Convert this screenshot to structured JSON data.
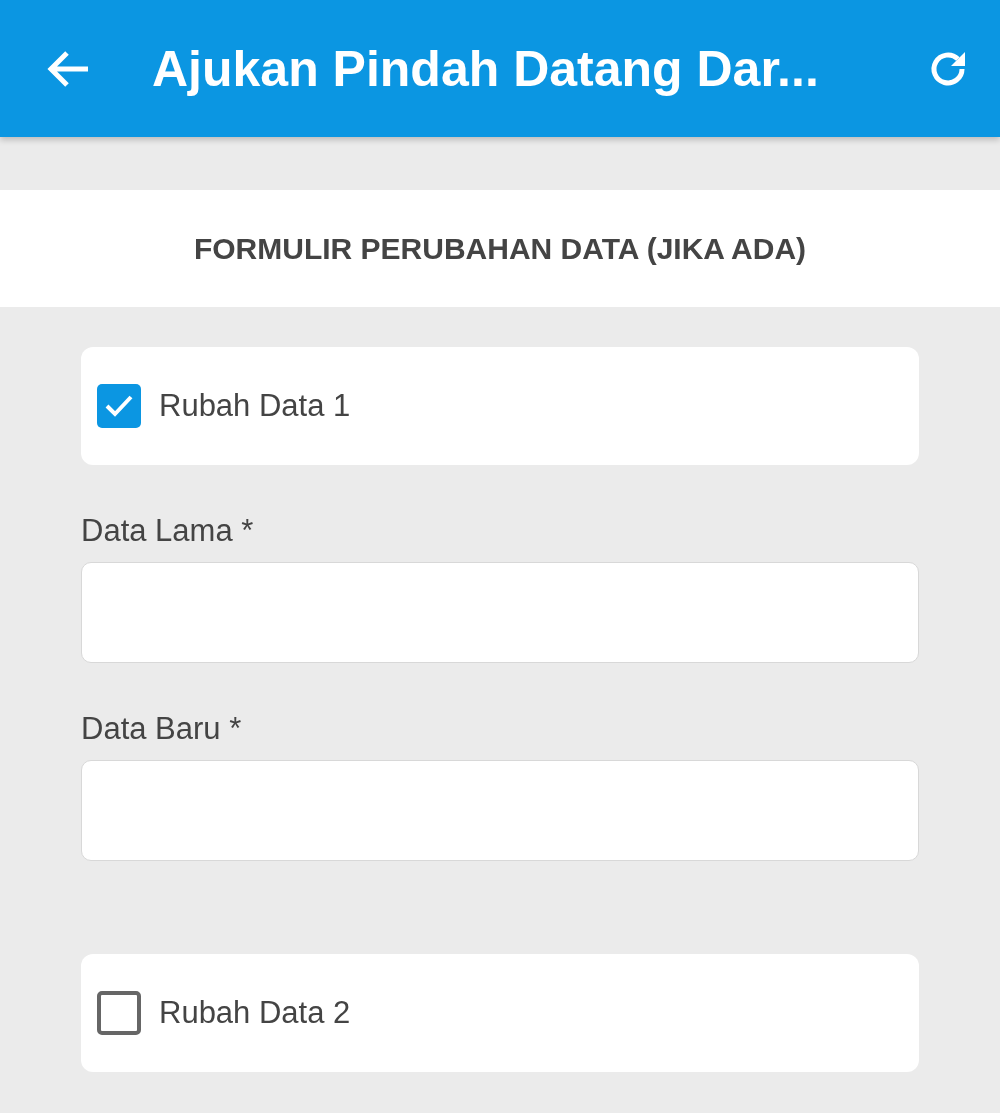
{
  "app_bar": {
    "title": "Ajukan Pindah Datang Dar..."
  },
  "section": {
    "title": "FORMULIR PERUBAHAN DATA (JIKA ADA)"
  },
  "form_items": [
    {
      "kind": "checkbox",
      "label": "Rubah Data 1",
      "checked": true
    },
    {
      "kind": "field",
      "label": "Data Lama *"
    },
    {
      "kind": "field",
      "label": "Data Baru *"
    },
    {
      "kind": "checkbox",
      "label": "Rubah Data 2",
      "checked": false
    }
  ]
}
